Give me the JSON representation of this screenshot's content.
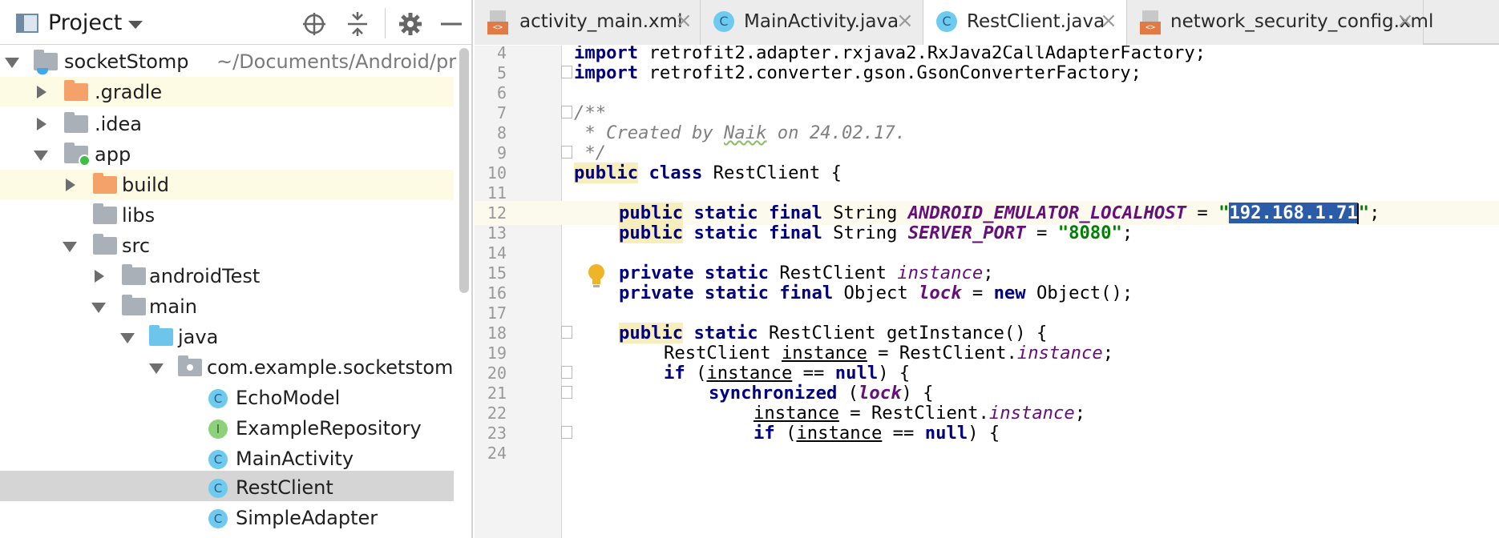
{
  "project_panel": {
    "title": "Project",
    "tree": [
      {
        "label": "socketStomp",
        "hint": "~/Documents/Android/pr"
      },
      {
        "label": ".gradle"
      },
      {
        "label": ".idea"
      },
      {
        "label": "app"
      },
      {
        "label": "build"
      },
      {
        "label": "libs"
      },
      {
        "label": "src"
      },
      {
        "label": "androidTest"
      },
      {
        "label": "main"
      },
      {
        "label": "java"
      },
      {
        "label": "com.example.socketstom"
      },
      {
        "label": "EchoModel"
      },
      {
        "label": "ExampleRepository"
      },
      {
        "label": "MainActivity"
      },
      {
        "label": "RestClient"
      },
      {
        "label": "SimpleAdapter"
      }
    ],
    "icon_glyphs": {
      "class": "C",
      "interface": "I"
    }
  },
  "tabs": [
    {
      "label": "activity_main.xml",
      "icon": "xml-file-icon",
      "badge": "<>"
    },
    {
      "label": "MainActivity.java",
      "icon": "java-class-icon"
    },
    {
      "label": "RestClient.java",
      "icon": "java-class-icon",
      "active": true
    },
    {
      "label": "network_security_config.xml",
      "icon": "xml-file-icon",
      "badge": "<>"
    }
  ],
  "tab_close_glyph": "×",
  "editor": {
    "lines": [
      "4",
      "5",
      "6",
      "7",
      "8",
      "9",
      "10",
      "11",
      "12",
      "13",
      "14",
      "15",
      "16",
      "17",
      "18",
      "19",
      "20",
      "21",
      "22",
      "23",
      "24"
    ],
    "code": {
      "l4_kw": "import",
      "l4_rest": " retrofit2.adapter.rxjava2.RxJava2CallAdapterFactory;",
      "l5_kw": "import",
      "l5_rest": " retrofit2.converter.gson.GsonConverterFactory;",
      "l7": "/**",
      "l8_a": " * Created by ",
      "l8_b": "Naik",
      "l8_c": " on 24.02.17.",
      "l9": " */",
      "l10_kw1": "public",
      "l10_kw2": "class",
      "l10_rest": " RestClient {",
      "l12_kw1": "public",
      "l12_kw2": "static",
      "l12_kw3": "final",
      "l12_type": " String ",
      "l12_const": "ANDROID_EMULATOR_LOCALHOST",
      "l12_eq": " = ",
      "l12_q1": "\"",
      "l12_sel": "192.168.1.71",
      "l12_q2": "\"",
      "l12_end": ";",
      "l13_kw1": "public",
      "l13_kw2": "static",
      "l13_kw3": "final",
      "l13_type": " String ",
      "l13_const": "SERVER_PORT",
      "l13_eq": " = ",
      "l13_str": "\"8080\"",
      "l13_end": ";",
      "l15_kw1": "private",
      "l15_kw2": "static",
      "l15_type": " RestClient ",
      "l15_fld": "instance",
      "l15_end": ";",
      "l16_kw1": "private",
      "l16_kw2": "static",
      "l16_kw3": "final",
      "l16_type": " Object ",
      "l16_fld": "lock",
      "l16_eq": " = ",
      "l16_kw4": "new",
      "l16_end": " Object();",
      "l18_kw1": "public",
      "l18_kw2": "static",
      "l18_rest": " RestClient getInstance() {",
      "l19_a": "RestClient ",
      "l19_var": "instance",
      "l19_b": " = RestClient.",
      "l19_fld": "instance",
      "l19_end": ";",
      "l20_kw": "if",
      "l20_a": " (",
      "l20_var": "instance",
      "l20_b": " == ",
      "l20_null": "null",
      "l20_end": ") {",
      "l21_kw": "synchronized",
      "l21_a": " (",
      "l21_fld": "lock",
      "l21_end": ") {",
      "l22_var": "instance",
      "l22_a": " = RestClient.",
      "l22_fld": "instance",
      "l22_end": ";",
      "l23_kw": "if",
      "l23_a": " (",
      "l23_var": "instance",
      "l23_b": " == ",
      "l23_null": "null",
      "l23_end": ") {"
    }
  }
}
